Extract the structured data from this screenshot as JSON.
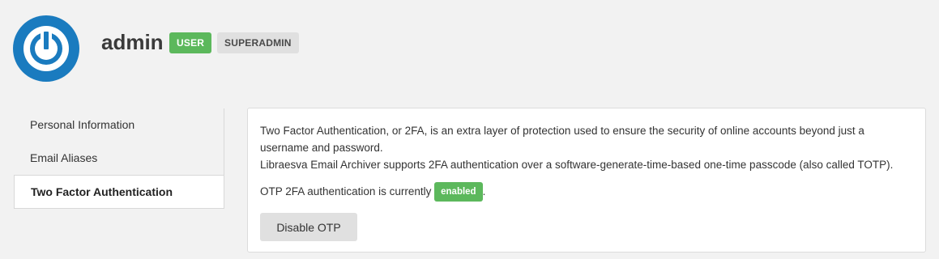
{
  "header": {
    "username": "admin",
    "badges": [
      "USER",
      "SUPERADMIN"
    ],
    "avatar_icon": "power-icon",
    "avatar_color": "#1a7bbf"
  },
  "sidebar": {
    "items": [
      {
        "label": "Personal Information",
        "active": false
      },
      {
        "label": "Email Aliases",
        "active": false
      },
      {
        "label": "Two Factor Authentication",
        "active": true
      }
    ]
  },
  "main": {
    "intro_line1": "Two Factor Authentication, or 2FA, is an extra layer of protection used to ensure the security of online accounts beyond just a username and password.",
    "intro_line2": "Libraesva Email Archiver supports 2FA authentication over a software-generate-time-based one-time passcode (also called TOTP).",
    "status_prefix": "OTP 2FA authentication is currently",
    "status_value": "enabled",
    "status_suffix": ".",
    "disable_button": "Disable OTP"
  },
  "colors": {
    "success": "#5cb85c",
    "neutral_badge": "#e0e0e0",
    "background": "#f2f2f2"
  }
}
